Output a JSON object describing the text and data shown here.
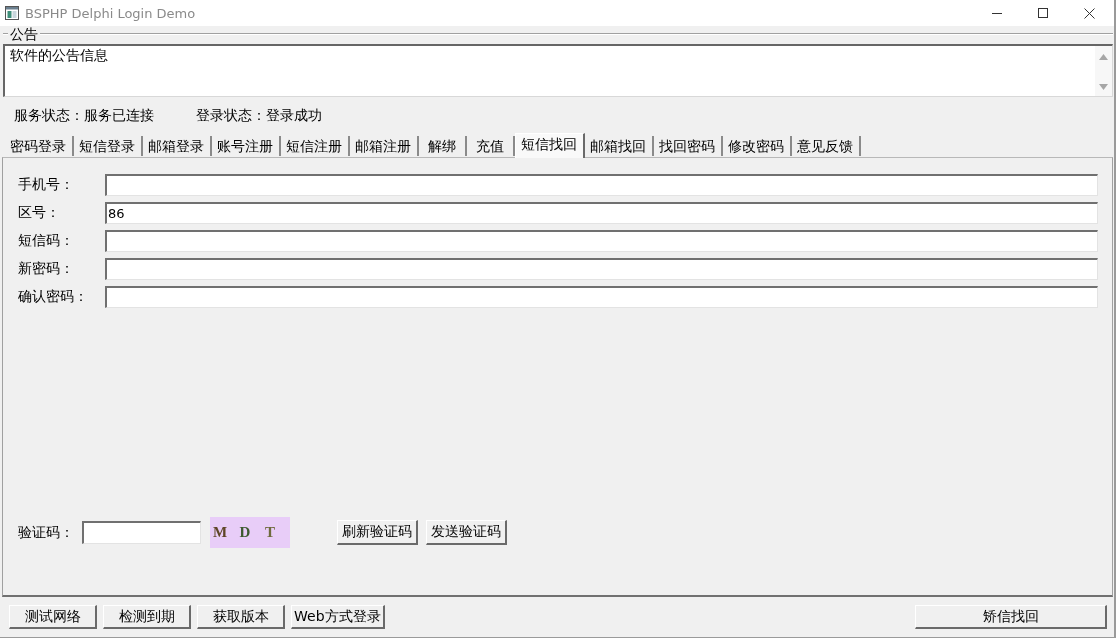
{
  "window": {
    "title": "BSPHP Delphi Login Demo"
  },
  "notice": {
    "label": "公告",
    "text": "软件的公告信息"
  },
  "status": [
    "服务状态：服务已连接",
    "登录状态：登录成功"
  ],
  "tabs": [
    {
      "label": "密码登录",
      "selected": false
    },
    {
      "label": "短信登录",
      "selected": false
    },
    {
      "label": "邮箱登录",
      "selected": false
    },
    {
      "label": "账号注册",
      "selected": false
    },
    {
      "label": "短信注册",
      "selected": false
    },
    {
      "label": "邮箱注册",
      "selected": false
    },
    {
      "label": "解绑",
      "selected": false
    },
    {
      "label": "充值",
      "selected": false
    },
    {
      "label": "短信找回",
      "selected": true
    },
    {
      "label": "邮箱找回",
      "selected": false
    },
    {
      "label": "找回密码",
      "selected": false
    },
    {
      "label": "修改密码",
      "selected": false
    },
    {
      "label": "意见反馈",
      "selected": false
    }
  ],
  "form": {
    "fields": [
      {
        "label": "手机号："
      },
      {
        "label": "区号：",
        "value": "86"
      },
      {
        "label": "短信码："
      },
      {
        "label": "新密码："
      },
      {
        "label": "确认密码："
      }
    ]
  },
  "captcha": {
    "label": "验证码：",
    "letters": [
      {
        "char": "M",
        "color": "#5e4527"
      },
      {
        "char": "D",
        "color": "#3d5a30"
      },
      {
        "char": "T",
        "color": "#6e6a3c"
      }
    ],
    "buttons": [
      "刷新验证码",
      "发送验证码"
    ]
  },
  "bottom_bar": {
    "buttons": [
      "测试网络",
      "检测到期",
      "获取版本",
      "Web方式登录"
    ],
    "submit": "矫信找回"
  }
}
